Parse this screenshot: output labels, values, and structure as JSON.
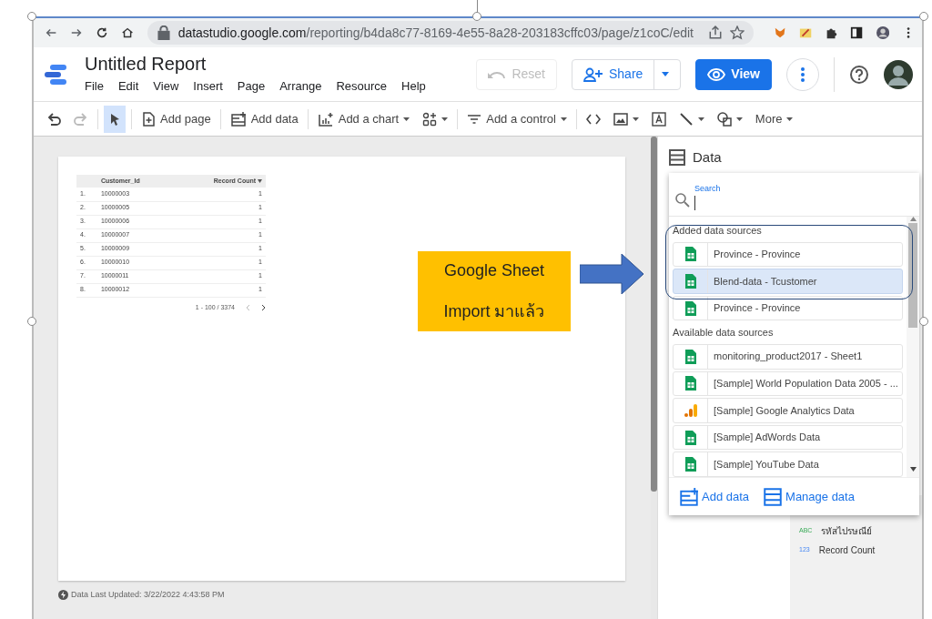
{
  "browser": {
    "url_host": "datastudio.google.com",
    "url_path": "/reporting/b4da8c77-8169-4e55-8a28-203183cffc03/page/z1coC/edit"
  },
  "app": {
    "title": "Untitled Report",
    "menu": [
      "File",
      "Edit",
      "View",
      "Insert",
      "Page",
      "Arrange",
      "Resource",
      "Help"
    ],
    "buttons": [
      {
        "kind": "reset",
        "label": "Reset",
        "disabled": true
      },
      {
        "kind": "share",
        "label": "Share",
        "disabled": false
      },
      {
        "kind": "view",
        "label": "View",
        "disabled": false
      }
    ]
  },
  "toolbar": [
    {
      "kind": "undo",
      "disabled": false,
      "selected": false
    },
    {
      "kind": "redo",
      "disabled": true,
      "selected": false
    },
    {
      "kind": "select",
      "disabled": false,
      "selected": true
    },
    {
      "kind": "add-page",
      "label": "Add page",
      "disabled": false,
      "selected": false
    },
    {
      "kind": "add-data",
      "label": "Add data",
      "disabled": false,
      "selected": false
    },
    {
      "kind": "chart",
      "label": "Add a chart",
      "disabled": false,
      "selected": false
    },
    {
      "kind": "community",
      "disabled": false,
      "selected": false
    },
    {
      "kind": "control",
      "label": "Add a control",
      "disabled": false,
      "selected": false
    },
    {
      "kind": "embed",
      "disabled": false,
      "selected": false
    },
    {
      "kind": "image",
      "disabled": false,
      "selected": false
    },
    {
      "kind": "text",
      "disabled": false,
      "selected": false
    },
    {
      "kind": "line",
      "disabled": false,
      "selected": false
    },
    {
      "kind": "shape",
      "disabled": false,
      "selected": false
    },
    {
      "kind": "more",
      "label": "More",
      "disabled": false,
      "selected": false
    }
  ],
  "table": {
    "columns": [
      "",
      "Customer_Id",
      "Record Count"
    ],
    "rows": [
      [
        "1.",
        "10000003",
        "1"
      ],
      [
        "2.",
        "10000005",
        "1"
      ],
      [
        "3.",
        "10000006",
        "1"
      ],
      [
        "4.",
        "10000007",
        "1"
      ],
      [
        "5.",
        "10000009",
        "1"
      ],
      [
        "6.",
        "10000010",
        "1"
      ],
      [
        "7.",
        "10000011",
        "1"
      ],
      [
        "8.",
        "10000012",
        "1"
      ]
    ],
    "pagination": "1 - 100 / 3374"
  },
  "footer": "Data Last Updated: 3/22/2022 4:43:58 PM",
  "callout": [
    "Google Sheet",
    "Import มาแล้ว"
  ],
  "panel": {
    "title": "Data",
    "search_label": "Search",
    "groups": [
      {
        "title": "Added data sources",
        "items": [
          {
            "name": "Province - Province",
            "kind": "sheets",
            "selected": false
          },
          {
            "name": "Blend-data - Tcustomer",
            "kind": "sheets",
            "selected": true
          },
          {
            "name": "Province - Province",
            "kind": "sheets",
            "selected": false
          }
        ]
      },
      {
        "title": "Available data sources",
        "items": [
          {
            "name": "monitoring_product2017 - Sheet1",
            "kind": "sheets",
            "selected": false
          },
          {
            "name": "[Sample] World Population Data 2005 - ...",
            "kind": "sheets",
            "selected": false
          },
          {
            "name": "[Sample] Google Analytics Data",
            "kind": "analytics",
            "selected": false
          },
          {
            "name": "[Sample] AdWords Data",
            "kind": "sheets",
            "selected": false
          },
          {
            "name": "[Sample] YouTube Data",
            "kind": "sheets",
            "selected": false
          }
        ]
      }
    ],
    "actions": [
      {
        "kind": "add",
        "label": "Add data"
      },
      {
        "kind": "manage",
        "label": "Manage data"
      }
    ],
    "fields": [
      {
        "type": "ABC",
        "name": "รหัสไปรษณีย์"
      },
      {
        "type": "123",
        "name": "Record Count"
      }
    ]
  }
}
